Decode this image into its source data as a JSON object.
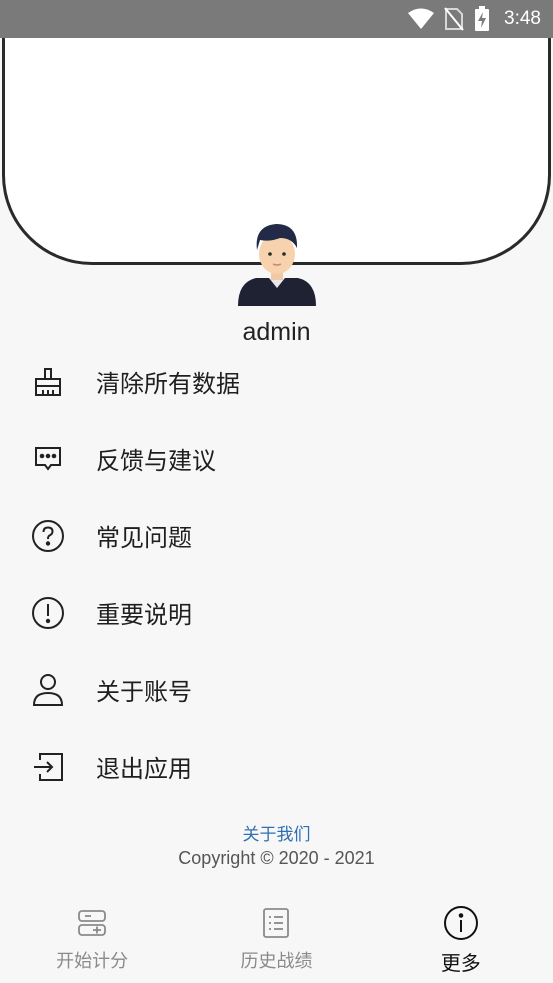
{
  "status_bar": {
    "time": "3:48"
  },
  "profile": {
    "username": "admin"
  },
  "menu": {
    "items": [
      {
        "label": "清除所有数据",
        "icon": "broom-icon"
      },
      {
        "label": "反馈与建议",
        "icon": "feedback-icon"
      },
      {
        "label": "常见问题",
        "icon": "question-circle-icon"
      },
      {
        "label": "重要说明",
        "icon": "exclamation-circle-icon"
      },
      {
        "label": "关于账号",
        "icon": "person-icon"
      },
      {
        "label": "退出应用",
        "icon": "logout-icon"
      }
    ]
  },
  "footer": {
    "about_link": "关于我们",
    "copyright": "Copyright © 2020 - 2021"
  },
  "tabs": [
    {
      "label": "开始计分",
      "icon": "scoreboard-icon",
      "active": false
    },
    {
      "label": "历史战绩",
      "icon": "list-icon",
      "active": false
    },
    {
      "label": "更多",
      "icon": "info-circle-icon",
      "active": true
    }
  ],
  "colors": {
    "link": "#2f6fb5",
    "status_bar": "#7a7a7a",
    "inactive_tab": "#8a8a8a"
  }
}
